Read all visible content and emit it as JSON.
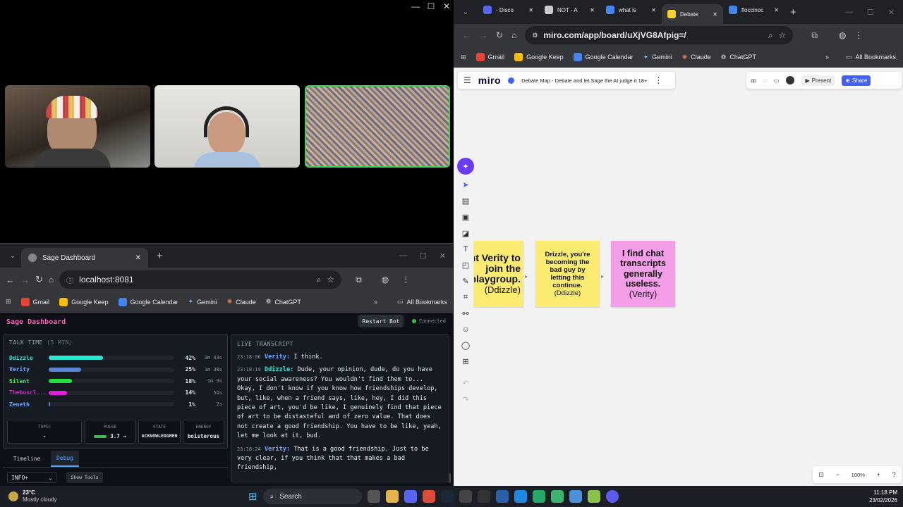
{
  "video_window": {
    "participants": [
      {
        "name": "Ddizzle-video",
        "style": "warm"
      },
      {
        "name": "Verity-video",
        "style": "light"
      },
      {
        "name": "Screen-share",
        "style": "pixelated"
      }
    ]
  },
  "sage_browser": {
    "tab_title": "Sage Dashboard",
    "url": "localhost:8081",
    "bookmarks": [
      "Gmail",
      "Google Keep",
      "Google Calendar",
      "Gemini",
      "Claude",
      "ChatGPT"
    ],
    "all_bookmarks": "All Bookmarks"
  },
  "dashboard": {
    "title": "Sage Dashboard",
    "restart_label": "Restart Bot",
    "status": "Connected",
    "talk_time_title": "TALK TIME",
    "talk_time_sub": "(5 MIN)",
    "speakers": [
      {
        "name": "Ddizzle",
        "pct": "42%",
        "value": 0.42,
        "time": "2m 43s",
        "color": "#2ee6d6",
        "name_color": "#2ee6d6"
      },
      {
        "name": "Verity",
        "pct": "25%",
        "value": 0.25,
        "time": "1m 38s",
        "color": "#5b86d6",
        "name_color": "#6ea8ff"
      },
      {
        "name": "Silent",
        "pct": "18%",
        "value": 0.18,
        "time": "1m 9s",
        "color": "#22e03a",
        "name_color": "#3ef05a"
      },
      {
        "name": "Theboscl...",
        "pct": "14%",
        "value": 0.14,
        "time": "54s",
        "color": "#e020d8",
        "name_color": "#e020d8"
      },
      {
        "name": "Zeneth",
        "pct": "1%",
        "value": 0.01,
        "time": "2s",
        "color": "#5b86d6",
        "name_color": "#6ea8ff"
      }
    ],
    "stats": {
      "topic_label": "TOPIC",
      "topic_value": "-",
      "pulse_label": "PULSE",
      "pulse_value": "3.7 →",
      "state_label": "STATE",
      "state_value": "ACKNOWLEDGMEN",
      "energy_label": "ENERGY",
      "energy_value": "boisterous"
    },
    "tabs": [
      "Timeline",
      "Debug"
    ],
    "level_select": "INFO+",
    "show_tools": "Show Tools",
    "transcript_title": "LIVE TRANSCRIPT",
    "transcript": [
      {
        "time": "23:18:06",
        "speaker": "Verity:",
        "color": "#6ea8ff",
        "text": "I think."
      },
      {
        "time": "23:18:19",
        "speaker": "Ddizzle:",
        "color": "#2ee6d6",
        "text": "Dude, your opinion, dude, do you have your social awareness? You wouldn't find them to... Okay, I don't know if you know how friendships develop, but, like, when a friend says, like, hey, I did this piece of art, you'd be like, I genuinely find that piece of art to be distasteful and of zero value. That does not create a good friendship. You have to be like, yeah, let me look at it, bud."
      },
      {
        "time": "23:18:24",
        "speaker": "Verity:",
        "color": "#6ea8ff",
        "text": "That is a good friendship. Just to be very clear, if you think that that makes a bad friendship,"
      }
    ]
  },
  "miro_browser": {
    "tabs": [
      "- Disco",
      "NOT - A",
      "what is",
      "Debate",
      "floccinoc"
    ],
    "url": "miro.com/app/board/uXjVG8Afpig=/",
    "bookmarks": [
      "Gmail",
      "Google Keep",
      "Google Calendar",
      "Gemini",
      "Claude",
      "ChatGPT"
    ],
    "all_bookmarks": "All Bookmarks",
    "logo": "miro",
    "board_title": "Debate Map - Debate and let Sage the AI judge it 18+",
    "present": "Present",
    "share": "Share",
    "zoom": "100%",
    "notes": [
      {
        "text": "I want Verity to join the playgroup.",
        "author": "(Ddizzle)",
        "color": "#fbeb71"
      },
      {
        "text": "Drizzle, you're becoming the bad guy by letting this continue.",
        "author": "(Ddizzle)",
        "color": "#fbeb71"
      },
      {
        "text": "I find chat transcripts generally useless.",
        "author": "(Verity)",
        "color": "#f59ee8"
      }
    ]
  },
  "taskbar": {
    "temp": "23°C",
    "weather": "Mostly cloudy",
    "search": "Search",
    "time": "11:18 PM",
    "date": "23/02/2026"
  }
}
